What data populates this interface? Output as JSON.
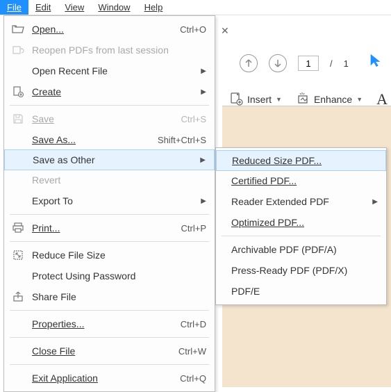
{
  "menubar": {
    "file": "File",
    "edit": "Edit",
    "view": "View",
    "window": "Window",
    "help": "Help"
  },
  "file_menu": {
    "open": "Open...",
    "open_sc": "Ctrl+O",
    "reopen": "Reopen PDFs from last session",
    "open_recent": "Open Recent File",
    "create": "Create",
    "save": "Save",
    "save_sc": "Ctrl+S",
    "save_as": "Save As...",
    "save_as_sc": "Shift+Ctrl+S",
    "save_as_other": "Save as Other",
    "revert": "Revert",
    "export_to": "Export To",
    "print": "Print...",
    "print_sc": "Ctrl+P",
    "reduce_file_size": "Reduce File Size",
    "protect_password": "Protect Using Password",
    "share_file": "Share File",
    "properties": "Properties...",
    "properties_sc": "Ctrl+D",
    "close_file": "Close File",
    "close_file_sc": "Ctrl+W",
    "exit_app": "Exit Application",
    "exit_app_sc": "Ctrl+Q"
  },
  "submenu": {
    "reduced_size": "Reduced Size PDF...",
    "certified": "Certified PDF...",
    "reader_extended": "Reader Extended PDF",
    "optimized": "Optimized PDF...",
    "archivable": "Archivable PDF (PDF/A)",
    "press_ready": "Press-Ready PDF (PDF/X)",
    "pdf_e": "PDF/E"
  },
  "page_nav": {
    "current": "1",
    "sep": "/",
    "total": "1"
  },
  "toolbar": {
    "insert": "Insert",
    "enhance": "Enhance"
  }
}
